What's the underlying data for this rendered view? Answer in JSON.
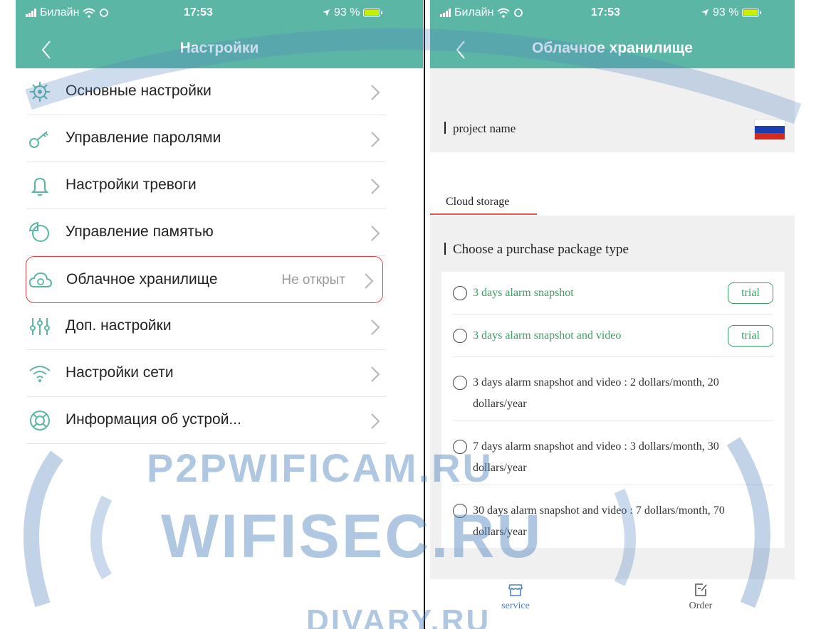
{
  "left": {
    "status": {
      "carrier": "Билайн",
      "time": "17:53",
      "battery": "93 %"
    },
    "nav": {
      "title": "Настройки"
    },
    "items": [
      {
        "label": "Основные настройки",
        "value": "",
        "icon": "gear-icon"
      },
      {
        "label": "Управление паролями",
        "value": "",
        "icon": "key-icon"
      },
      {
        "label": "Настройки тревоги",
        "value": "",
        "icon": "bell-icon"
      },
      {
        "label": "Управление памятью",
        "value": "",
        "icon": "pie-chart-icon"
      },
      {
        "label": "Облачное хранилище",
        "value": "Не открыт",
        "icon": "cloud-icon"
      },
      {
        "label": "Доп. настройки",
        "value": "",
        "icon": "sliders-icon"
      },
      {
        "label": "Настройки сети",
        "value": "",
        "icon": "wifi-icon"
      },
      {
        "label": "Информация об устрой...",
        "value": "",
        "icon": "lifebuoy-icon"
      }
    ]
  },
  "right": {
    "status": {
      "carrier": "Билайн",
      "time": "17:53",
      "battery": "93 %"
    },
    "nav": {
      "title": "Облачное хранилище"
    },
    "project_label": "project name",
    "tab_label": "Cloud storage",
    "choose_label": "Choose a purchase package type",
    "packages": [
      {
        "text": "3 days alarm snapshot",
        "badge": "trial"
      },
      {
        "text": "3 days alarm snapshot and video",
        "badge": "trial"
      },
      {
        "text": "3 days alarm snapshot and video : 2 dollars/month, 20 dollars/year",
        "badge": ""
      },
      {
        "text": "7 days alarm snapshot and video : 3 dollars/month, 30 dollars/year",
        "badge": ""
      },
      {
        "text": "30 days alarm snapshot and video : 7 dollars/month, 70 dollars/year",
        "badge": ""
      }
    ],
    "tabbar": {
      "service": "service",
      "order": "Order"
    }
  },
  "colors": {
    "header": "#5bb6a5",
    "highlight": "#e0424a",
    "green": "#3a9f62",
    "tab_underline": "#e9534f"
  },
  "watermark": {
    "line1": "P2PWIFICAM.RU",
    "line2": "WIFISEC.RU",
    "line3": "DIVARY.RU"
  }
}
